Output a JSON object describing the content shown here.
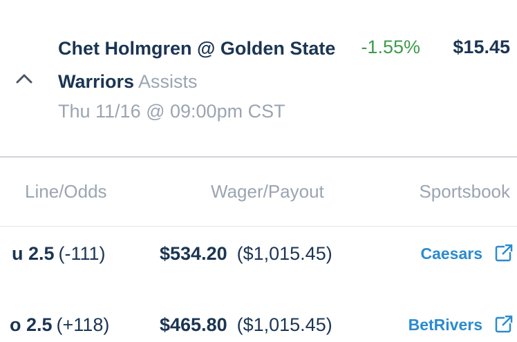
{
  "bet": {
    "title": "Chet Holmgren @ Golden State Warriors",
    "market": "Assists",
    "time": "Thu 11/16 @ 09:00pm CST",
    "percent": "-1.55%",
    "amount": "$15.45"
  },
  "columns": {
    "line_odds": "Line/Odds",
    "wager_payout": "Wager/Payout",
    "sportsbook": "Sportsbook"
  },
  "rows": [
    {
      "side": "u 2.5",
      "odds": "(-111)",
      "stake": "$534.20",
      "payout": "($1,015.45)",
      "book": "Caesars"
    },
    {
      "side": "o 2.5",
      "odds": "(+118)",
      "stake": "$465.80",
      "payout": "($1,015.45)",
      "book": "BetRivers"
    }
  ],
  "colors": {
    "primary_text": "#1b3553",
    "muted_text": "#9aa5b1",
    "negative_green": "#3d9a4a",
    "link_blue": "#2a8bd0"
  },
  "icons": {
    "collapse": "chevron-up-icon",
    "external": "external-link-icon"
  }
}
